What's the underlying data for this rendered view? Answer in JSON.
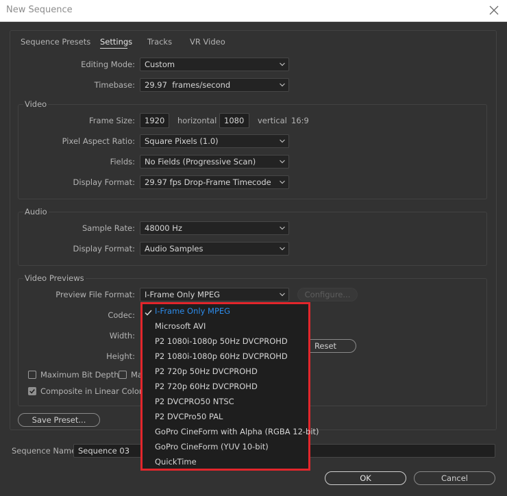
{
  "window": {
    "title": "New Sequence"
  },
  "tabs": [
    {
      "label": "Sequence Presets"
    },
    {
      "label": "Settings"
    },
    {
      "label": "Tracks"
    },
    {
      "label": "VR Video"
    }
  ],
  "general": {
    "editing_mode_label": "Editing Mode:",
    "editing_mode_value": "Custom",
    "timebase_label": "Timebase:",
    "timebase_value": "29.97  frames/second"
  },
  "video": {
    "title": "Video",
    "frame_size_label": "Frame Size:",
    "frame_width": "1920",
    "horizontal_label": "horizontal",
    "frame_height": "1080",
    "vertical_label": "vertical",
    "aspect_ratio": "16:9",
    "pixel_aspect_label": "Pixel Aspect Ratio:",
    "pixel_aspect_value": "Square Pixels (1.0)",
    "fields_label": "Fields:",
    "fields_value": "No Fields (Progressive Scan)",
    "display_format_label": "Display Format:",
    "display_format_value": "29.97 fps Drop-Frame Timecode"
  },
  "audio": {
    "title": "Audio",
    "sample_rate_label": "Sample Rate:",
    "sample_rate_value": "48000 Hz",
    "display_format_label": "Display Format:",
    "display_format_value": "Audio Samples"
  },
  "previews": {
    "title": "Video Previews",
    "file_format_label": "Preview File Format:",
    "file_format_value": "I-Frame Only MPEG",
    "configure_label": "Configure...",
    "codec_label": "Codec:",
    "width_label": "Width:",
    "height_label": "Height:",
    "reset_label": "Reset",
    "max_bit_depth_label": "Maximum Bit Depth",
    "max_render_label_partial": "Ma",
    "composite_label": "Composite in Linear Color (re",
    "composite_checked": true
  },
  "save_preset_label": "Save Preset...",
  "sequence_name_label": "Sequence Name:",
  "sequence_name_value": "Sequence 03",
  "ok_label": "OK",
  "cancel_label": "Cancel",
  "dropdown": {
    "selected": "I-Frame Only MPEG",
    "items": [
      "I-Frame Only MPEG",
      "Microsoft AVI",
      "P2 1080i-1080p 50Hz DVCPROHD",
      "P2 1080i-1080p 60Hz DVCPROHD",
      "P2 720p 50Hz DVCPROHD",
      "P2 720p 60Hz DVCPROHD",
      "P2 DVCPRO50 NTSC",
      "P2 DVCPro50 PAL",
      "GoPro CineForm with Alpha (RGBA 12-bit)",
      "GoPro CineForm (YUV 10-bit)",
      "QuickTime"
    ]
  },
  "colors": {
    "accent_blue": "#2d8ceb",
    "highlight_red": "#e3262c",
    "panel_bg": "#323232"
  }
}
